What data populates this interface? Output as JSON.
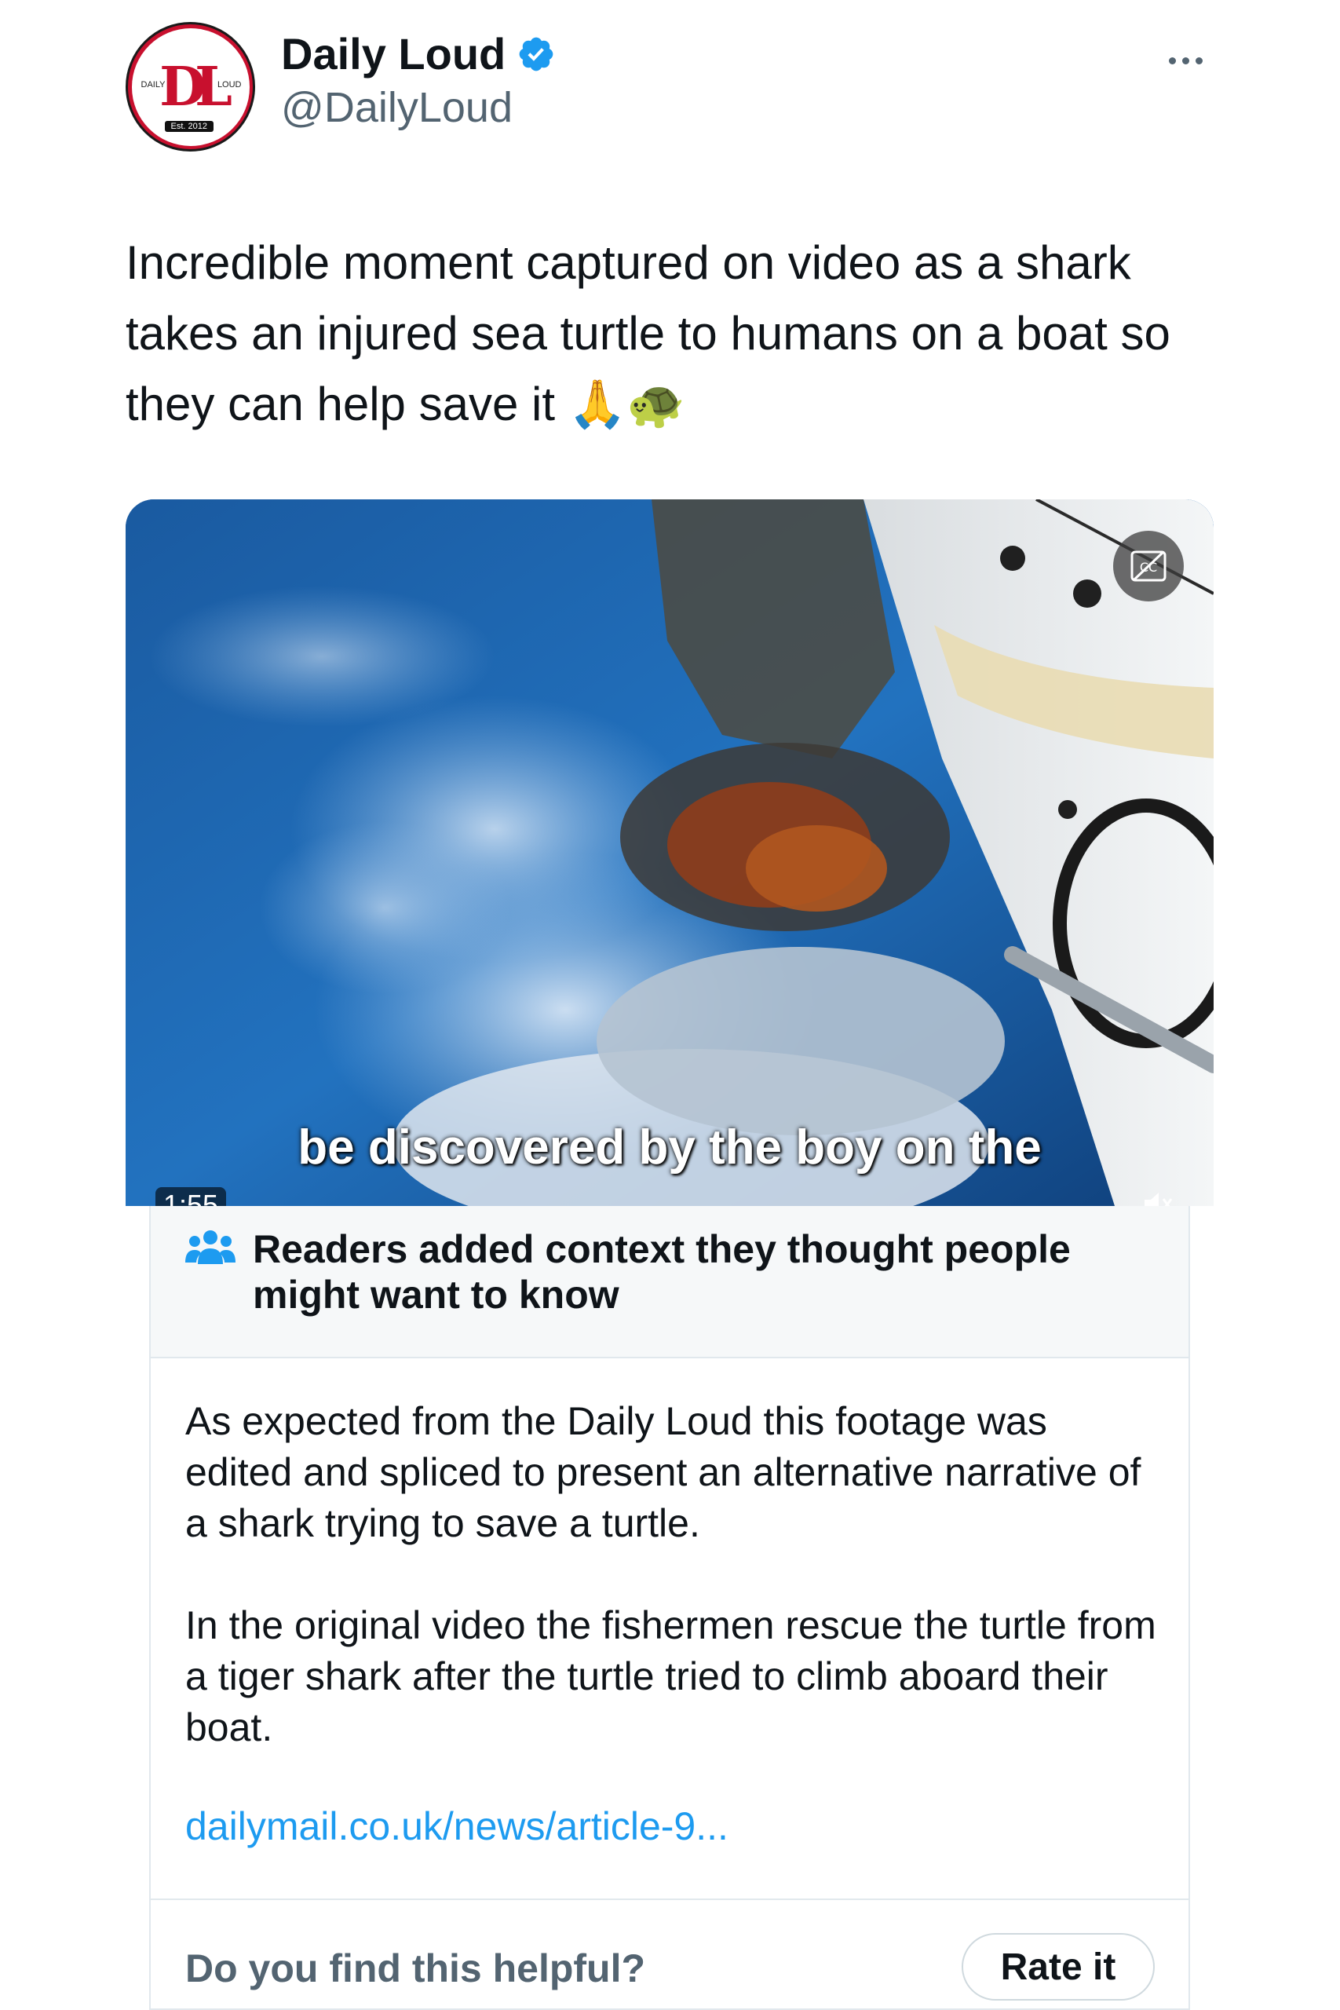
{
  "author": {
    "display_name": "Daily Loud",
    "handle": "@DailyLoud",
    "verified": true,
    "avatar": {
      "monogram": "DL",
      "left_text": "DAILY",
      "right_text": "LOUD",
      "est_text": "Est. 2012"
    }
  },
  "tweet": {
    "text": "Incredible moment captured on video as a shark takes an injured sea turtle to humans on a boat so they can help save it 🙏🐢"
  },
  "video": {
    "subtitle": "be discovered by the boy on the",
    "duration_partial": "1:55"
  },
  "community_note": {
    "title": "Readers added context they thought people might want to know",
    "paragraphs": [
      "As expected from the Daily Loud this footage was edited and spliced to present an alternative narrative of a shark trying to save a turtle.",
      "In the original video the fishermen rescue the turtle from a tiger shark after the turtle tried to climb aboard their boat."
    ],
    "link": "dailymail.co.uk/news/article-9...",
    "footer_question": "Do you find this helpful?",
    "rate_button": "Rate it"
  },
  "colors": {
    "text_primary": "#0f1419",
    "text_secondary": "#536471",
    "link": "#1d9bf0",
    "verified": "#1d9bf0",
    "brand_red": "#c8102e"
  },
  "icons": {
    "more": "more-icon",
    "verified": "verified-badge-icon",
    "captions": "captions-icon",
    "mute": "mute-icon",
    "community": "people-icon"
  }
}
